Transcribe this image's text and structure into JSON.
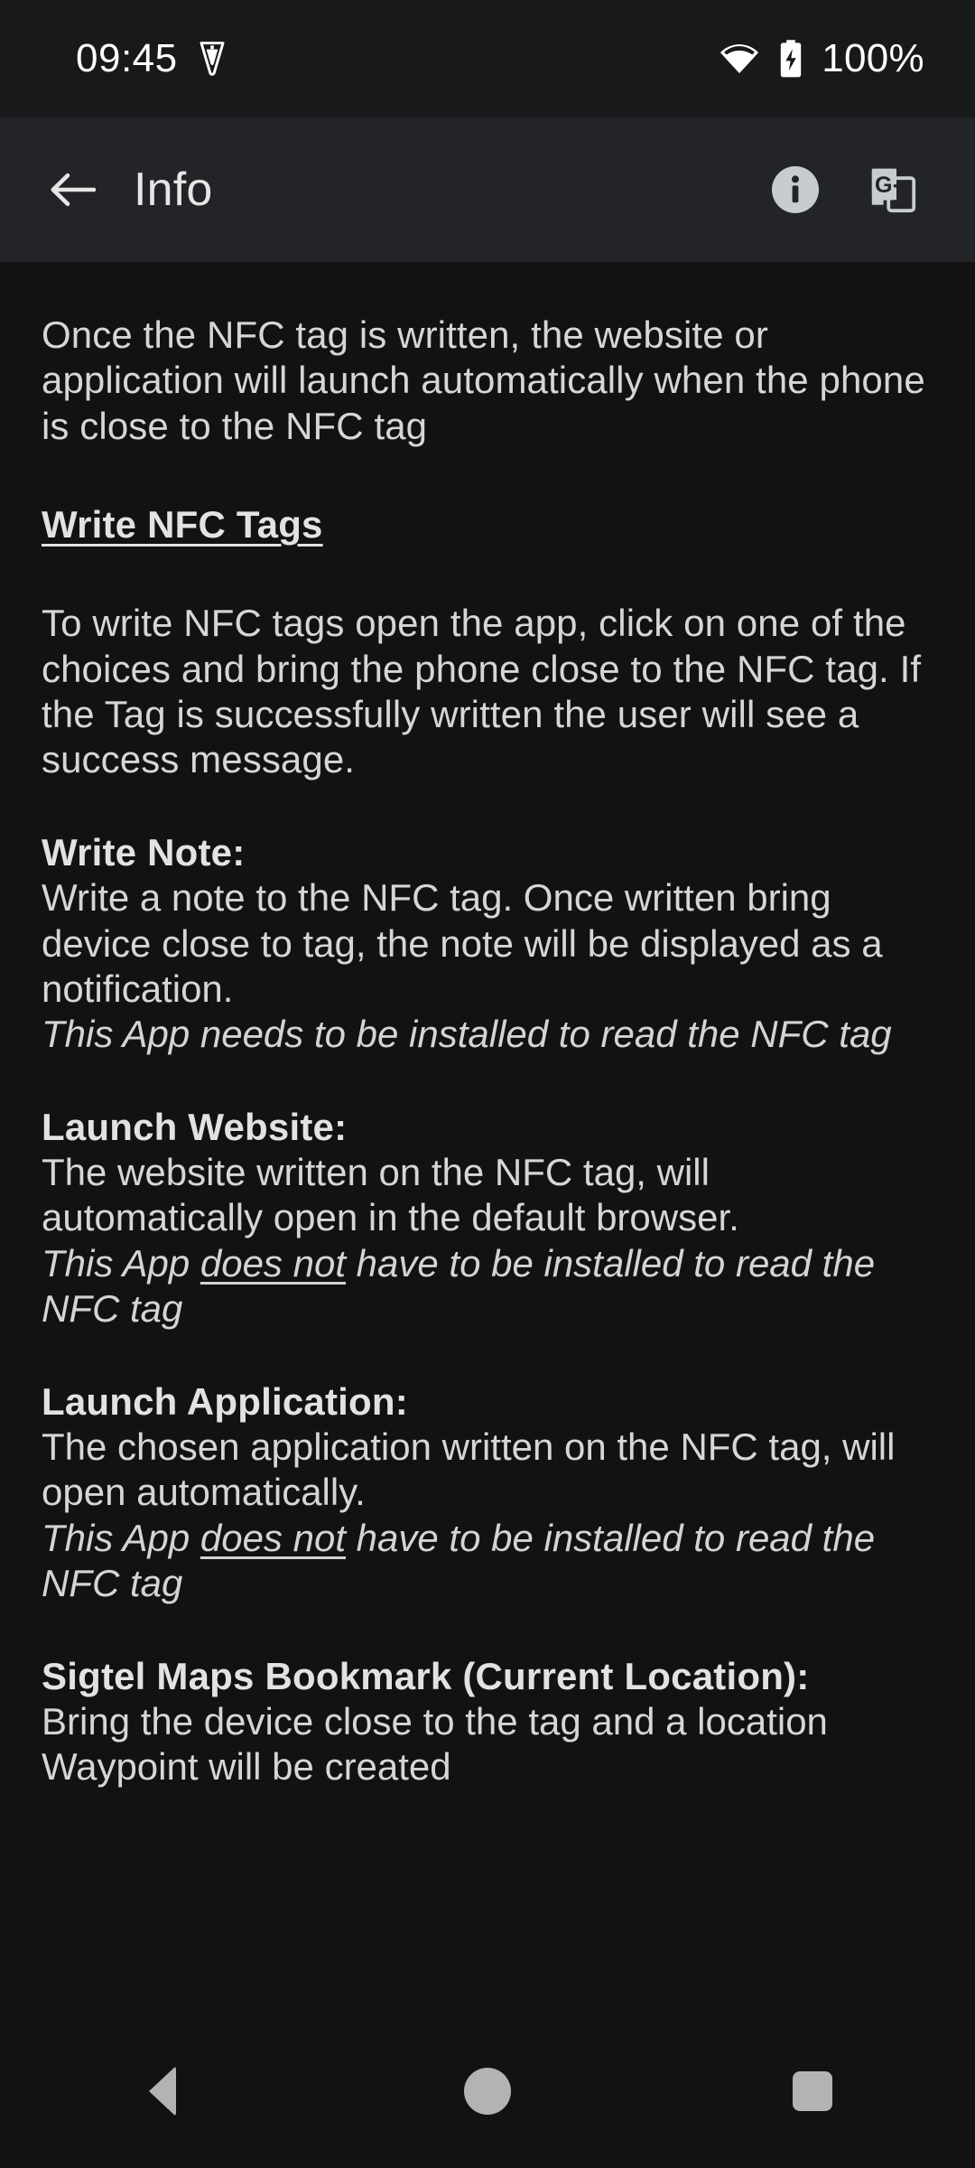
{
  "status_bar": {
    "clock": "09:45",
    "icons": [
      "vpn-key-icon",
      "wifi-icon",
      "battery-charging-icon"
    ],
    "battery_percent": "100%"
  },
  "app_bar": {
    "back_label": "back-arrow",
    "title": "Info",
    "actions": [
      "info-icon",
      "google-translate-icon"
    ]
  },
  "content": {
    "intro_paragraph": "Once the NFC tag is written, the website or application will launch automatically when the phone is close to the NFC tag",
    "section_heading": "Write NFC Tags",
    "write_paragraph": "To write NFC tags open the app, click on one of the choices and bring the phone close to the NFC tag. If the Tag is successfully written the user will see a success message.",
    "sections": [
      {
        "title": "Write Note:",
        "body": "Write a note to the NFC tag. Once written bring device close to tag, the note will be displayed as a notification.",
        "note_prefix": "This App needs to be installed to read the NFC tag",
        "note_underlined": "",
        "note_suffix": ""
      },
      {
        "title": "Launch Website:",
        "body": "The website written on the NFC tag, will automatically open in the default browser.",
        "note_prefix": "This App ",
        "note_underlined": "does not",
        "note_suffix": " have to be installed to read the NFC tag"
      },
      {
        "title": "Launch Application:",
        "body": "The chosen application written on the NFC tag, will open automatically.",
        "note_prefix": "This App ",
        "note_underlined": "does not",
        "note_suffix": " have to be installed to read the NFC tag"
      },
      {
        "title": "Sigtel Maps Bookmark (Current Location):",
        "body": "Bring the device close to the tag and a location Waypoint will be created",
        "note_prefix": "",
        "note_underlined": "",
        "note_suffix": ""
      }
    ]
  },
  "nav_bar": {
    "back": "navigation-back",
    "home": "navigation-home",
    "recents": "navigation-recents"
  },
  "colors": {
    "status_bar_bg": "#18191b",
    "app_bar_bg": "#232427",
    "content_bg": "#121212",
    "body_text": "#d6d6d6",
    "title_text": "#e6e6e6",
    "nav_icon": "#b3b3b3"
  }
}
